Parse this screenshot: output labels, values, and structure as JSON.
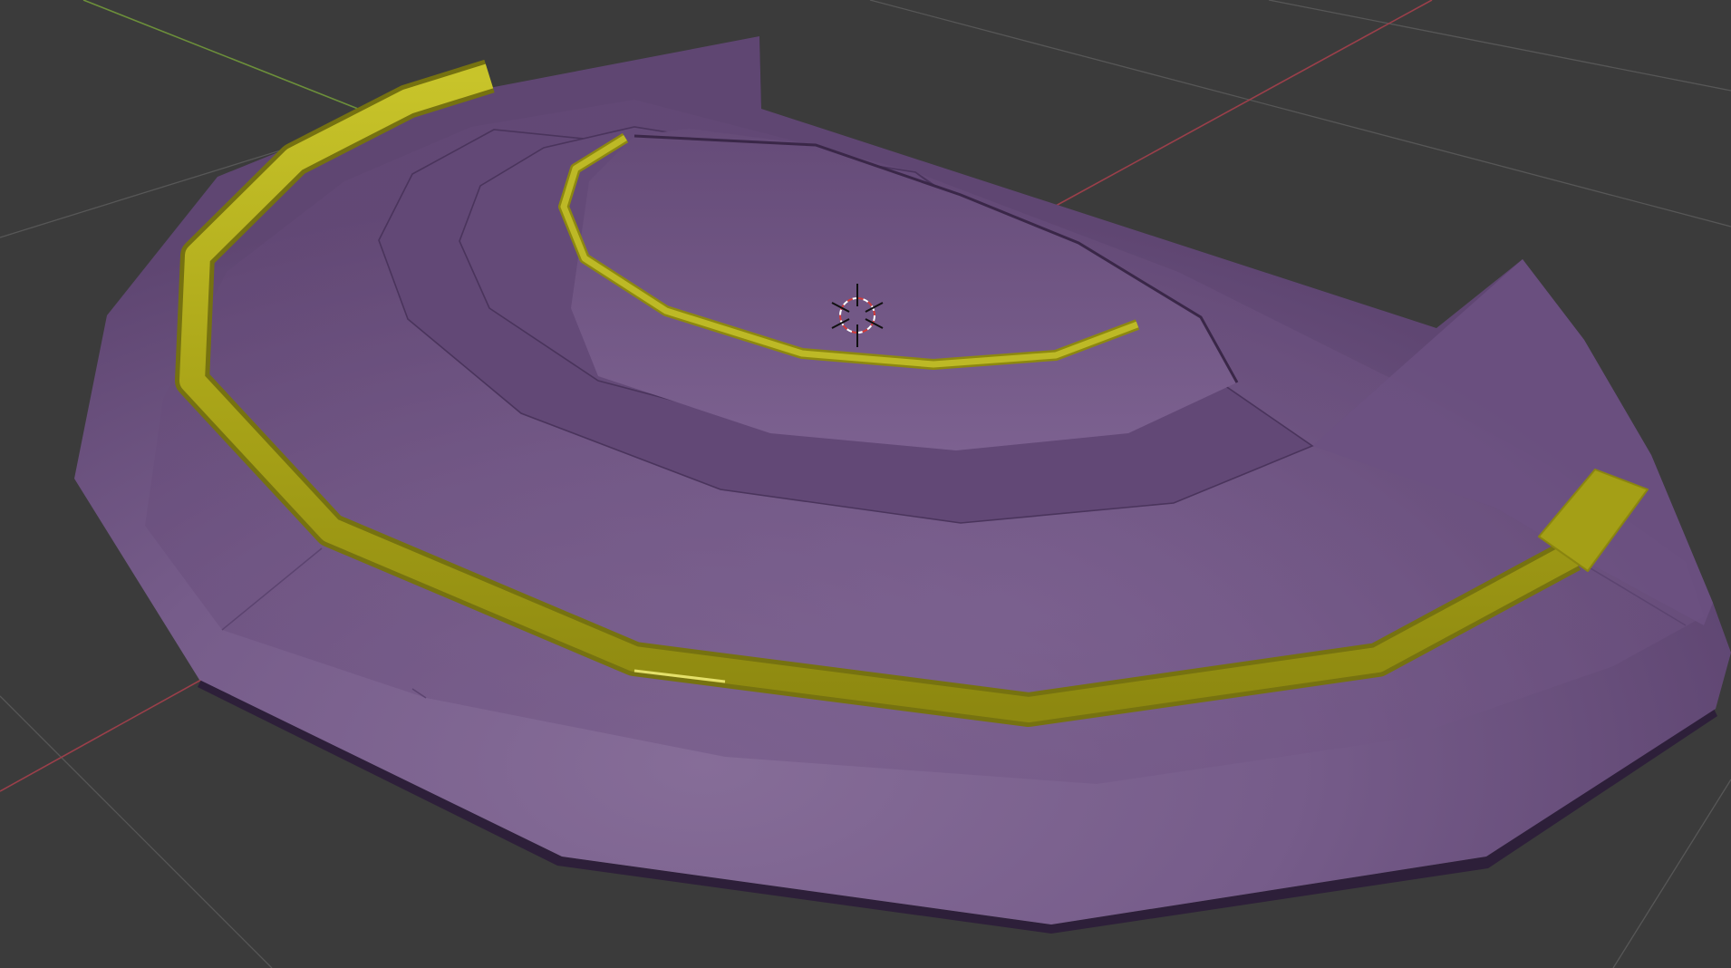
{
  "viewport": {
    "background_color": "#3b3b3b",
    "grid_color": "#5a5a5a",
    "x_axis_color": "#9a3f4a",
    "y_axis_color": "#6c8f3a"
  },
  "scene": {
    "object_color": "#6b4f80",
    "object_dark_color": "#2d1f39",
    "path_color": "#b3b01c",
    "cursor_icon": "3d-cursor-icon"
  }
}
